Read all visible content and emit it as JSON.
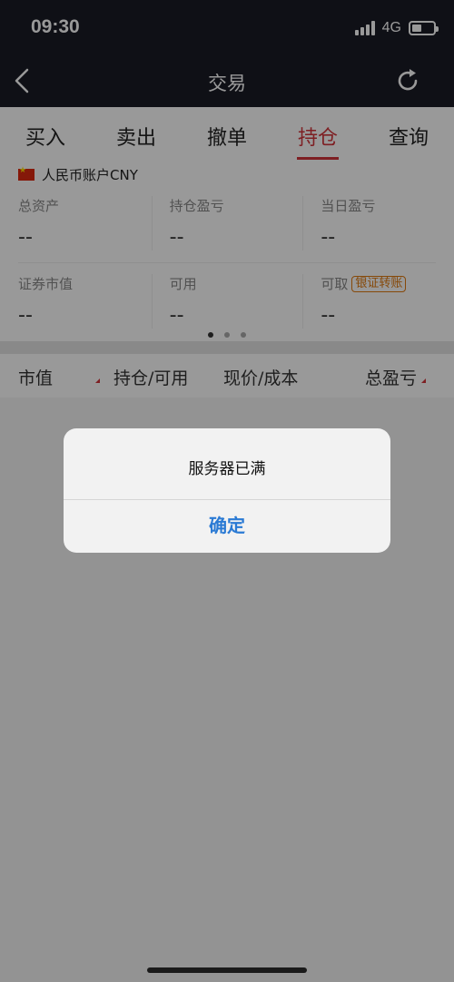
{
  "status_bar": {
    "time": "09:30",
    "network": "4G",
    "battery_level": 0.45
  },
  "nav": {
    "title": "交易",
    "back_icon": "chevron-left-icon",
    "refresh_icon": "refresh-icon"
  },
  "tabs": [
    {
      "label": "买入",
      "active": false
    },
    {
      "label": "卖出",
      "active": false
    },
    {
      "label": "撤单",
      "active": false
    },
    {
      "label": "持仓",
      "active": true
    },
    {
      "label": "查询",
      "active": false
    }
  ],
  "account": {
    "name": "人民币账户CNY",
    "flag_icon": "china-flag-icon",
    "stats_row1": [
      {
        "label": "总资产",
        "value": "--"
      },
      {
        "label": "持仓盈亏",
        "value": "--"
      },
      {
        "label": "当日盈亏",
        "value": "--"
      }
    ],
    "stats_row2": [
      {
        "label": "证券市值",
        "value": "--"
      },
      {
        "label": "可用",
        "value": "--"
      },
      {
        "label": "可取",
        "value": "--",
        "tag": "银证转账"
      }
    ],
    "page_count": 3,
    "active_page": 1
  },
  "columns": {
    "market_value": "市值",
    "position_available": "持仓/可用",
    "price_cost": "现价/成本",
    "total_pnl": "总盈亏"
  },
  "alert": {
    "message": "服务器已满",
    "confirm_label": "确定"
  },
  "colors": {
    "accent_red": "#d2343b",
    "tag_orange": "#e07a10",
    "confirm_blue": "#2a7ad4",
    "header_bg": "#1a1b26"
  }
}
